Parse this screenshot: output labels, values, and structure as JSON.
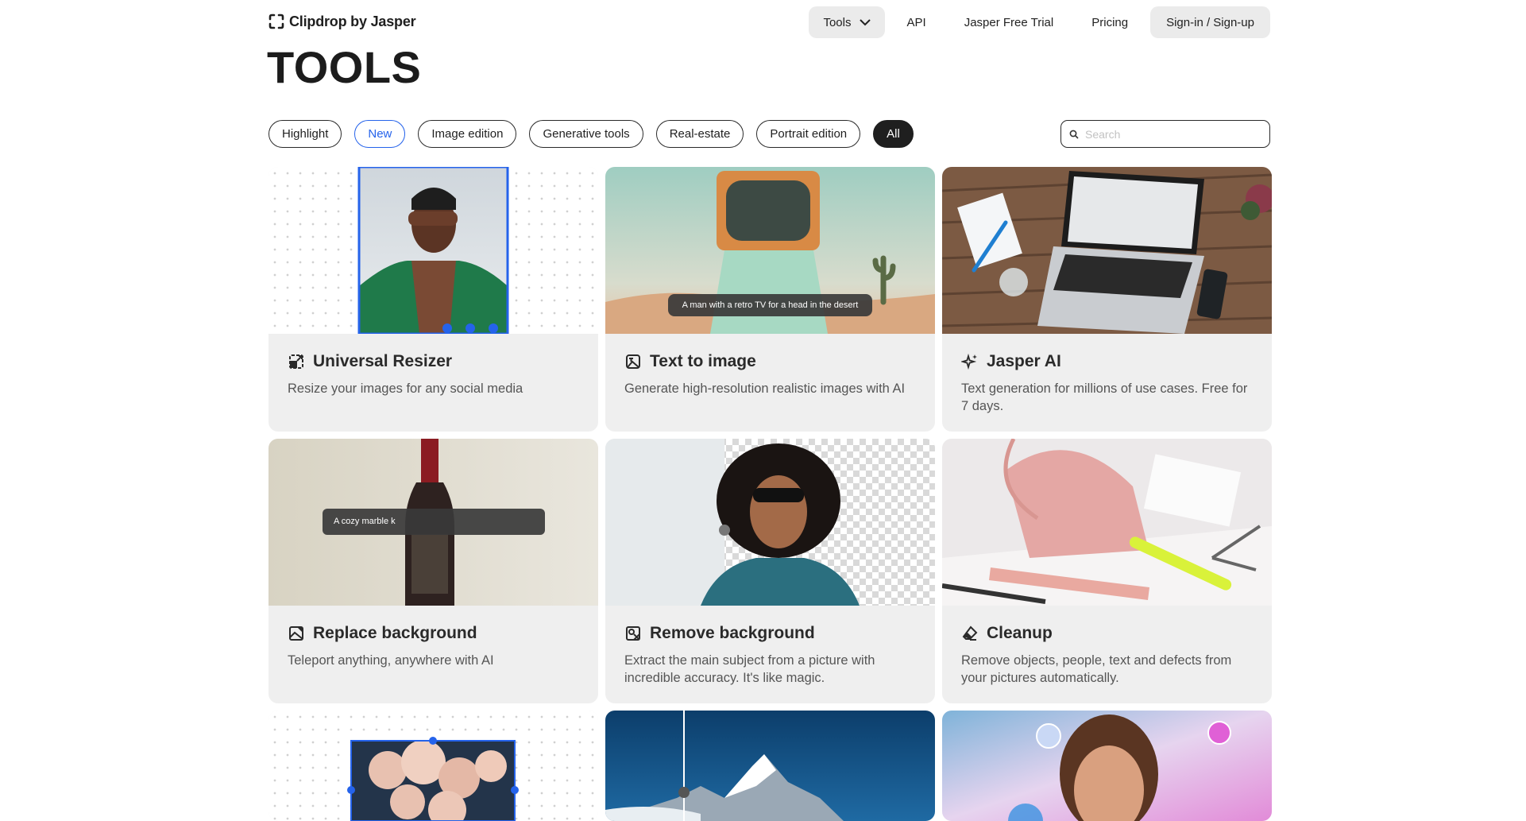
{
  "header": {
    "logo_text": "Clipdrop by Jasper",
    "nav": {
      "tools": "Tools",
      "api": "API",
      "trial": "Jasper Free Trial",
      "pricing": "Pricing",
      "signin": "Sign-in / Sign-up"
    }
  },
  "page_title": "TOOLS",
  "filters": [
    "Highlight",
    "New",
    "Image edition",
    "Generative tools",
    "Real-estate",
    "Portrait edition",
    "All"
  ],
  "active_filter": "All",
  "search": {
    "placeholder": "Search",
    "value": ""
  },
  "cards": [
    {
      "title": "Universal Resizer",
      "desc": "Resize your images for any social media",
      "icon": "resize-icon"
    },
    {
      "title": "Text to image",
      "desc": "Generate high-resolution realistic images with AI",
      "icon": "text-image-icon",
      "overlay": "A man with a retro TV for a head in the desert"
    },
    {
      "title": "Jasper AI",
      "desc": "Text generation for millions of use cases. Free for 7 days.",
      "icon": "sparkle-icon"
    },
    {
      "title": "Replace background",
      "desc": "Teleport anything, anywhere with AI",
      "icon": "replace-background-icon",
      "overlay": "A cozy marble k"
    },
    {
      "title": "Remove background",
      "desc": "Extract the main subject from a picture with incredible accuracy. It's like magic.",
      "icon": "remove-background-icon"
    },
    {
      "title": "Cleanup",
      "desc": "Remove objects, people, text and defects from your pictures automatically.",
      "icon": "eraser-icon"
    }
  ],
  "colors": {
    "accent": "#2563eb",
    "card_bg": "#efefef",
    "dark": "#1f1f1f"
  }
}
